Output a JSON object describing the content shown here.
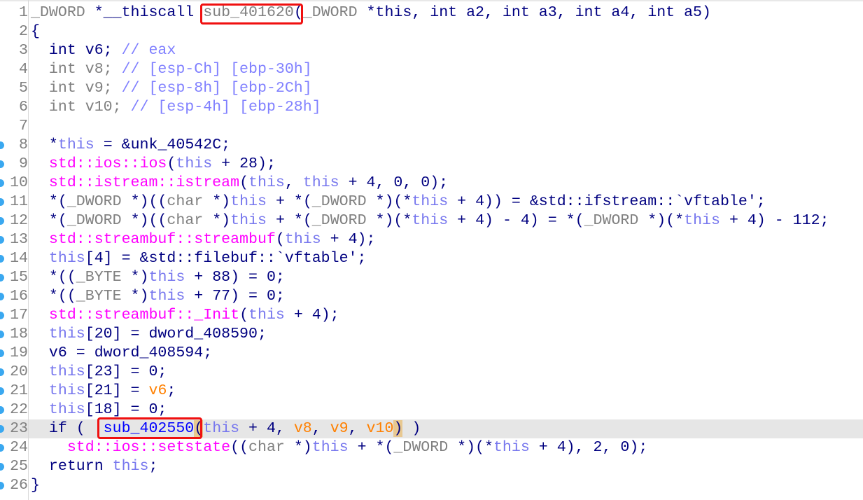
{
  "editor": {
    "breakpoint_lines": [
      8,
      9,
      10,
      11,
      12,
      13,
      14,
      15,
      16,
      17,
      18,
      19,
      20,
      21,
      22,
      23,
      24,
      25,
      26
    ],
    "current_line": 23,
    "colors": {
      "keyword": "#000080",
      "type": "#808080",
      "this": "#7777ee",
      "comment": "#8080ff",
      "library_call": "#ff00ff",
      "variable": "#ff8000",
      "function": "#0000ff",
      "annotation_box": "#f01010"
    },
    "lines": [
      [
        [
          "_DWORD",
          "g"
        ],
        [
          " *__thiscall ",
          "n"
        ],
        [
          "sub_401620",
          "g"
        ],
        [
          "(",
          "n"
        ],
        [
          "_DWORD",
          "g"
        ],
        [
          " *",
          "n"
        ],
        [
          "this",
          "n"
        ],
        [
          ", int a2, int a3, int a4, int a5)",
          "n"
        ]
      ],
      [
        [
          "{",
          "n"
        ]
      ],
      [
        [
          "  int v6; ",
          "n"
        ],
        [
          "// eax",
          "c"
        ]
      ],
      [
        [
          "  int v8; ",
          "g"
        ],
        [
          "// [esp-Ch] [ebp-30h]",
          "c"
        ]
      ],
      [
        [
          "  int v9; ",
          "g"
        ],
        [
          "// [esp-8h] [ebp-2Ch]",
          "c"
        ]
      ],
      [
        [
          "  int v10; ",
          "g"
        ],
        [
          "// [esp-4h] [ebp-28h]",
          "c"
        ]
      ],
      [],
      [
        [
          "  *",
          "n"
        ],
        [
          "this",
          "t"
        ],
        [
          " = &unk_40542C;",
          "n"
        ]
      ],
      [
        [
          "  ",
          "n"
        ],
        [
          "std::ios::ios",
          "f"
        ],
        [
          "(",
          "n"
        ],
        [
          "this",
          "t"
        ],
        [
          " + 28);",
          "n"
        ]
      ],
      [
        [
          "  ",
          "n"
        ],
        [
          "std::istream::istream",
          "f"
        ],
        [
          "(",
          "n"
        ],
        [
          "this",
          "t"
        ],
        [
          ", ",
          "n"
        ],
        [
          "this",
          "t"
        ],
        [
          " + 4, 0, 0);",
          "n"
        ]
      ],
      [
        [
          "  *(",
          "n"
        ],
        [
          "_DWORD",
          "g"
        ],
        [
          " *)((",
          "n"
        ],
        [
          "char",
          "g"
        ],
        [
          " *)",
          "n"
        ],
        [
          "this",
          "t"
        ],
        [
          " + *(",
          "n"
        ],
        [
          "_DWORD",
          "g"
        ],
        [
          " *)(*",
          "n"
        ],
        [
          "this",
          "t"
        ],
        [
          " + 4)) = &std::ifstream::`vftable';",
          "n"
        ]
      ],
      [
        [
          "  *(",
          "n"
        ],
        [
          "_DWORD",
          "g"
        ],
        [
          " *)((",
          "n"
        ],
        [
          "char",
          "g"
        ],
        [
          " *)",
          "n"
        ],
        [
          "this",
          "t"
        ],
        [
          " + *(",
          "n"
        ],
        [
          "_DWORD",
          "g"
        ],
        [
          " *)(*",
          "n"
        ],
        [
          "this",
          "t"
        ],
        [
          " + 4) - 4) = *(",
          "n"
        ],
        [
          "_DWORD",
          "g"
        ],
        [
          " *)(*",
          "n"
        ],
        [
          "this",
          "t"
        ],
        [
          " + 4) - 112;",
          "n"
        ]
      ],
      [
        [
          "  ",
          "n"
        ],
        [
          "std::streambuf::streambuf",
          "f"
        ],
        [
          "(",
          "n"
        ],
        [
          "this",
          "t"
        ],
        [
          " + 4);",
          "n"
        ]
      ],
      [
        [
          "  ",
          "n"
        ],
        [
          "this",
          "t"
        ],
        [
          "[4] = &std::filebuf::`vftable';",
          "n"
        ]
      ],
      [
        [
          "  *((",
          "n"
        ],
        [
          "_BYTE",
          "g"
        ],
        [
          " *)",
          "n"
        ],
        [
          "this",
          "t"
        ],
        [
          " + 88) = 0;",
          "n"
        ]
      ],
      [
        [
          "  *((",
          "n"
        ],
        [
          "_BYTE",
          "g"
        ],
        [
          " *)",
          "n"
        ],
        [
          "this",
          "t"
        ],
        [
          " + 77) = 0;",
          "n"
        ]
      ],
      [
        [
          "  ",
          "n"
        ],
        [
          "std::streambuf::_Init",
          "f"
        ],
        [
          "(",
          "n"
        ],
        [
          "this",
          "t"
        ],
        [
          " + 4);",
          "n"
        ]
      ],
      [
        [
          "  ",
          "n"
        ],
        [
          "this",
          "t"
        ],
        [
          "[20] = dword_408590;",
          "n"
        ]
      ],
      [
        [
          "  v6 = dword_408594;",
          "n"
        ]
      ],
      [
        [
          "  ",
          "n"
        ],
        [
          "this",
          "t"
        ],
        [
          "[23] = 0;",
          "n"
        ]
      ],
      [
        [
          "  ",
          "n"
        ],
        [
          "this",
          "t"
        ],
        [
          "[21] = ",
          "n"
        ],
        [
          "v6",
          "o"
        ],
        [
          ";",
          "n"
        ]
      ],
      [
        [
          "  ",
          "n"
        ],
        [
          "this",
          "t"
        ],
        [
          "[18] = 0;",
          "n"
        ]
      ],
      [
        [
          "  if (  ",
          "n"
        ],
        [
          "sub_402550",
          "b"
        ],
        [
          "(",
          "p"
        ],
        [
          "this",
          "t"
        ],
        [
          " + 4, ",
          "n"
        ],
        [
          "v8",
          "o"
        ],
        [
          ", ",
          "n"
        ],
        [
          "v9",
          "o"
        ],
        [
          ", ",
          "n"
        ],
        [
          "v10",
          "o"
        ],
        [
          ")",
          "p"
        ],
        [
          " )",
          "n"
        ]
      ],
      [
        [
          "    ",
          "n"
        ],
        [
          "std::ios::setstate",
          "f"
        ],
        [
          "((",
          "n"
        ],
        [
          "char",
          "g"
        ],
        [
          " *)",
          "n"
        ],
        [
          "this",
          "t"
        ],
        [
          " + *(",
          "n"
        ],
        [
          "_DWORD",
          "g"
        ],
        [
          " *)(*",
          "n"
        ],
        [
          "this",
          "t"
        ],
        [
          " + 4), 2, 0);",
          "n"
        ]
      ],
      [
        [
          "  return ",
          "n"
        ],
        [
          "this",
          "t"
        ],
        [
          ";",
          "n"
        ]
      ],
      [
        [
          "}",
          "n"
        ]
      ]
    ]
  }
}
